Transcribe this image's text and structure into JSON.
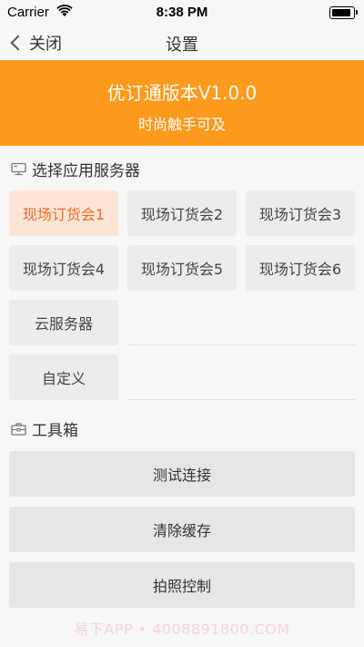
{
  "status_bar": {
    "carrier": "Carrier",
    "time": "8:38 PM"
  },
  "nav": {
    "back_label": "关闭",
    "title": "设置"
  },
  "banner": {
    "app_name": "优订通版本V1.0.0",
    "slogan": "时尚触手可及",
    "color": "#fb9a1d"
  },
  "server_section": {
    "title": "选择应用服务器",
    "icon": "server-icon",
    "servers": [
      {
        "label": "现场订货会1",
        "selected": true
      },
      {
        "label": "现场订货会2",
        "selected": false
      },
      {
        "label": "现场订货会3",
        "selected": false
      },
      {
        "label": "现场订货会4",
        "selected": false
      },
      {
        "label": "现场订货会5",
        "selected": false
      },
      {
        "label": "现场订货会6",
        "selected": false
      },
      {
        "label": "云服务器",
        "selected": false
      },
      {
        "label": "自定义",
        "selected": false
      }
    ],
    "selected_color": "#f06a2a"
  },
  "toolbox_section": {
    "title": "工具箱",
    "icon": "toolbox-icon",
    "buttons": [
      {
        "label": "测试连接"
      },
      {
        "label": "清除缓存"
      },
      {
        "label": "拍照控制"
      }
    ]
  },
  "watermark": "易下APP • 4008891800.COM"
}
